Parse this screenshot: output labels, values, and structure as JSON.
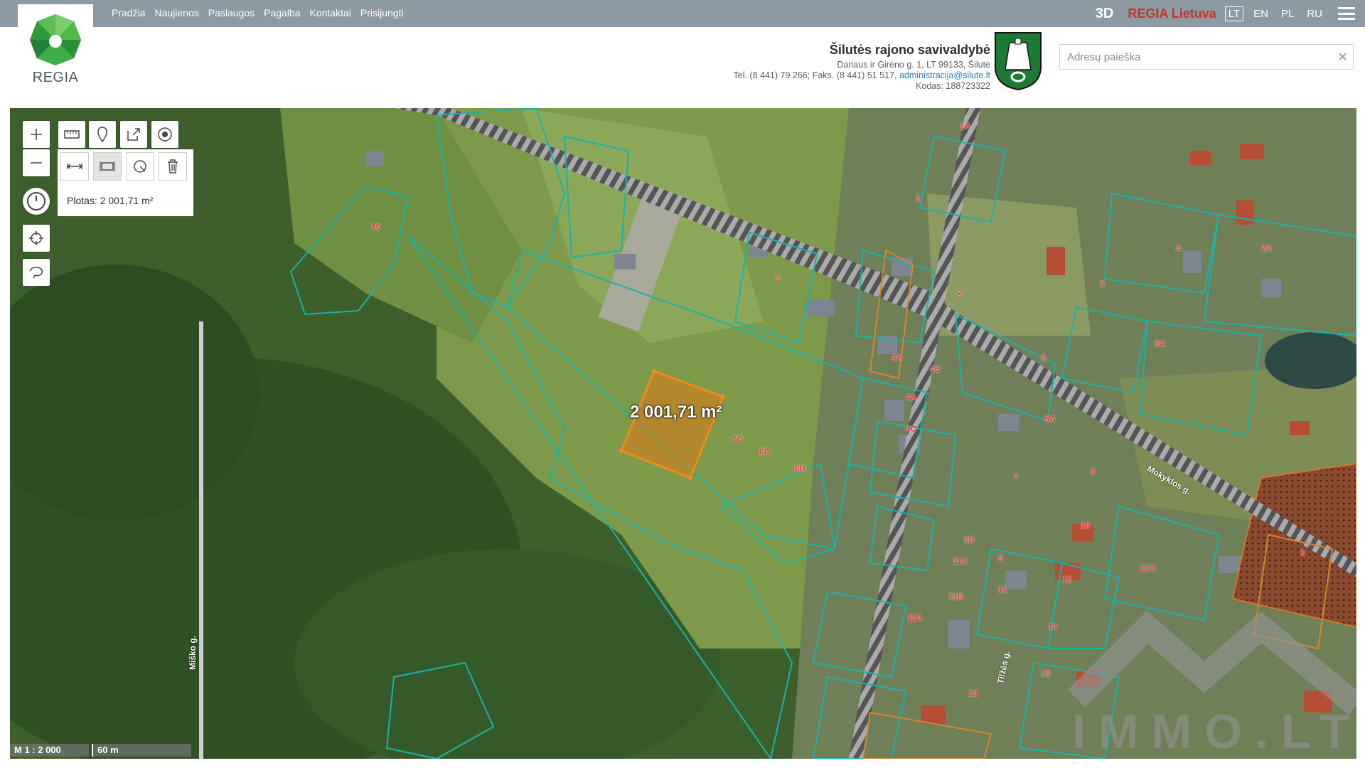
{
  "logo": {
    "text": "REGIA"
  },
  "nav": {
    "items": [
      "Pradžia",
      "Naujienos",
      "Paslaugos",
      "Pagalba",
      "Kontaktai",
      "Prisijungti"
    ]
  },
  "top_right": {
    "btn_3d": "3D",
    "regia_lt": "REGIA Lietuva",
    "languages": [
      "LT",
      "EN",
      "PL",
      "RU"
    ],
    "active_language": "LT"
  },
  "municipality": {
    "name": "Šilutės rajono savivaldybė",
    "address": "Dariaus ir Girėno g. 1, LT 99133, Šilutė",
    "phones": "Tel. (8 441) 79 266; Faks. (8 441) 51 517,",
    "email": "administracija@silute.lt",
    "code": "Kodas: 188723322"
  },
  "search": {
    "placeholder": "Adresų paieška",
    "clear_icon": "×"
  },
  "map": {
    "measure_result": "Plotas: 2 001,71 m²",
    "area_label": "2 001,71 m²",
    "scale_ratio": "M 1 : 2 000",
    "scale_length": "60 m",
    "streets": [
      "Miško g.",
      "Mokyklos g.",
      "Tilžės g."
    ],
    "parcel_numbers": [
      "1A",
      "1",
      "10",
      "6",
      "2",
      "3",
      "4",
      "5",
      "6C",
      "6A",
      "6B",
      "5A",
      "7",
      "8",
      "9",
      "10",
      "11",
      "11A",
      "11B",
      "11C",
      "5B",
      "4A",
      "4B",
      "4C",
      "14",
      "15",
      "13",
      "17A",
      "12",
      "2A",
      "4A",
      "6A",
      "3"
    ],
    "colors": {
      "parcel_border": "#19b3a8",
      "selection_fill": "#e07a16",
      "road": "#9c9c9c"
    },
    "watermark": "IMMO.LT"
  }
}
